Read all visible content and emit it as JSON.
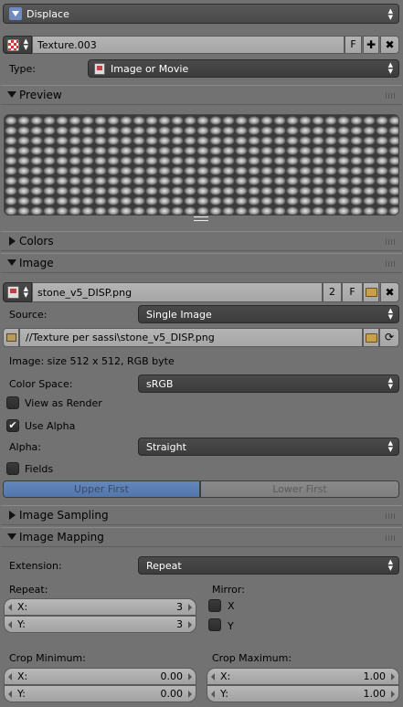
{
  "modifier": {
    "name": "Displace"
  },
  "texture": {
    "name": "Texture.003",
    "fake_user": "F",
    "type_label": "Type:",
    "type_value": "Image or Movie"
  },
  "panels": {
    "preview": "Preview",
    "colors": "Colors",
    "image": "Image",
    "image_sampling": "Image Sampling",
    "image_mapping": "Image Mapping"
  },
  "image": {
    "name": "stone_v5_DISP.png",
    "users": "2",
    "fake_user": "F",
    "source_label": "Source:",
    "source_value": "Single Image",
    "filepath": "//Texture per sassi\\stone_v5_DISP.png",
    "info": "Image: size 512 x 512, RGB byte",
    "color_space_label": "Color Space:",
    "color_space_value": "sRGB",
    "view_as_render": "View as Render",
    "view_as_render_checked": false,
    "use_alpha": "Use Alpha",
    "use_alpha_checked": true,
    "alpha_label": "Alpha:",
    "alpha_value": "Straight",
    "fields": "Fields",
    "fields_checked": false,
    "field_order": [
      "Upper First",
      "Lower First"
    ],
    "field_order_active": "Upper First"
  },
  "mapping": {
    "extension_label": "Extension:",
    "extension_value": "Repeat",
    "repeat_label": "Repeat:",
    "repeat_x_label": "X:",
    "repeat_x": "3",
    "repeat_y_label": "Y:",
    "repeat_y": "3",
    "mirror_label": "Mirror:",
    "mirror_x": "X",
    "mirror_y": "Y",
    "crop_min_label": "Crop Minimum:",
    "crop_min_x_label": "X:",
    "crop_min_x": "0.00",
    "crop_min_y_label": "Y:",
    "crop_min_y": "0.00",
    "crop_max_label": "Crop Maximum:",
    "crop_max_x_label": "X:",
    "crop_max_x": "1.00",
    "crop_max_y_label": "Y:",
    "crop_max_y": "1.00"
  },
  "colors": {
    "active_tab": "#5a80b5",
    "panel_bg": "#727272",
    "dark_widget": "#3c3c3c"
  }
}
